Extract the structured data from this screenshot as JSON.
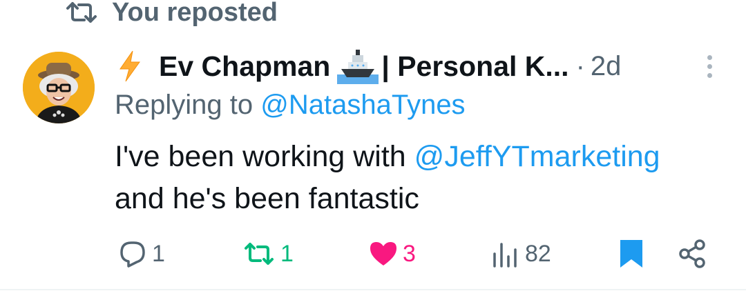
{
  "repost": {
    "label": "You reposted",
    "icon": "repost-icon"
  },
  "post": {
    "author": {
      "name": "Ev Chapman",
      "name_rest": "| Personal K...",
      "emoji_prefix": "lightning-icon",
      "emoji_mid": "ship-icon"
    },
    "separator": "·",
    "time": "2d",
    "replying_prefix": "Replying to",
    "replying_handle": "@NatashaTynes",
    "body_before": "I've been working with",
    "body_mention": "@JeffYTmarketing",
    "body_after": "and he's been fantastic"
  },
  "actions": {
    "reply_count": "1",
    "repost_count": "1",
    "like_count": "3",
    "views_count": "82"
  },
  "colors": {
    "secondary_text": "#536471",
    "link": "#1d9bf0",
    "repost_green": "#00ba7c",
    "like_pink": "#f91880",
    "bookmark_blue": "#1d9bf0"
  }
}
